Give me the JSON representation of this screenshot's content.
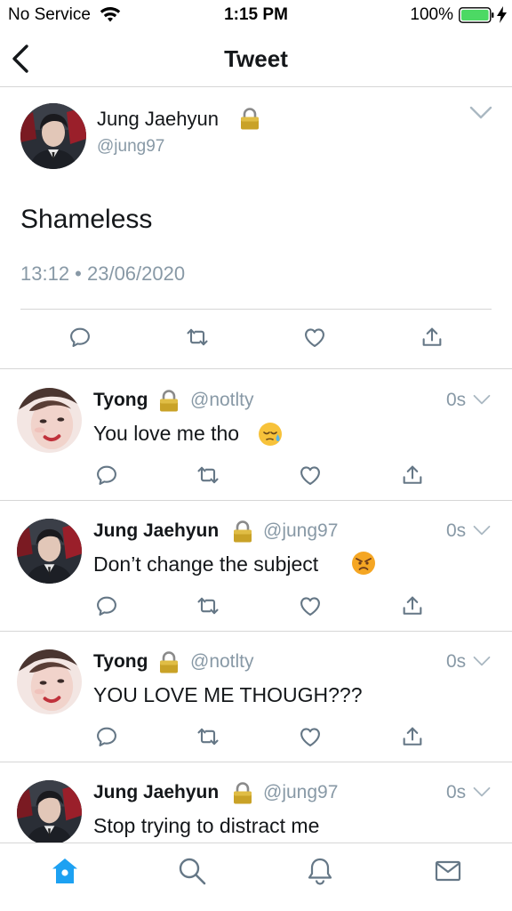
{
  "status_bar": {
    "carrier": "No Service",
    "time": "1:15 PM",
    "battery": "100%"
  },
  "nav": {
    "title": "Tweet"
  },
  "main_tweet": {
    "name": "Jung Jaehyun",
    "handle": "@jung97",
    "text": "Shameless",
    "timestamp": "13:12 • 23/06/2020",
    "locked": true
  },
  "replies": [
    {
      "name": "Tyong",
      "handle": "@notlty",
      "time": "0s",
      "text": "You love me tho",
      "emoji": "sleepy-face"
    },
    {
      "name": "Jung Jaehyun",
      "handle": "@jung97",
      "time": "0s",
      "text": "Don’t change the subject",
      "emoji": "angry-face"
    },
    {
      "name": "Tyong",
      "handle": "@notlty",
      "time": "0s",
      "text": "YOU LOVE ME THOUGH???"
    },
    {
      "name": "Jung Jaehyun",
      "handle": "@jung97",
      "time": "0s",
      "text": "Stop trying to distract me"
    }
  ],
  "tabs": [
    {
      "icon": "home-icon",
      "active": true
    },
    {
      "icon": "search-icon",
      "active": false
    },
    {
      "icon": "bell-icon",
      "active": false
    },
    {
      "icon": "mail-icon",
      "active": false
    }
  ],
  "colors": {
    "accent": "#1da1f2",
    "secondary_text": "#8899a6",
    "icon_gray": "#657786",
    "battery_green": "#4cd964"
  }
}
